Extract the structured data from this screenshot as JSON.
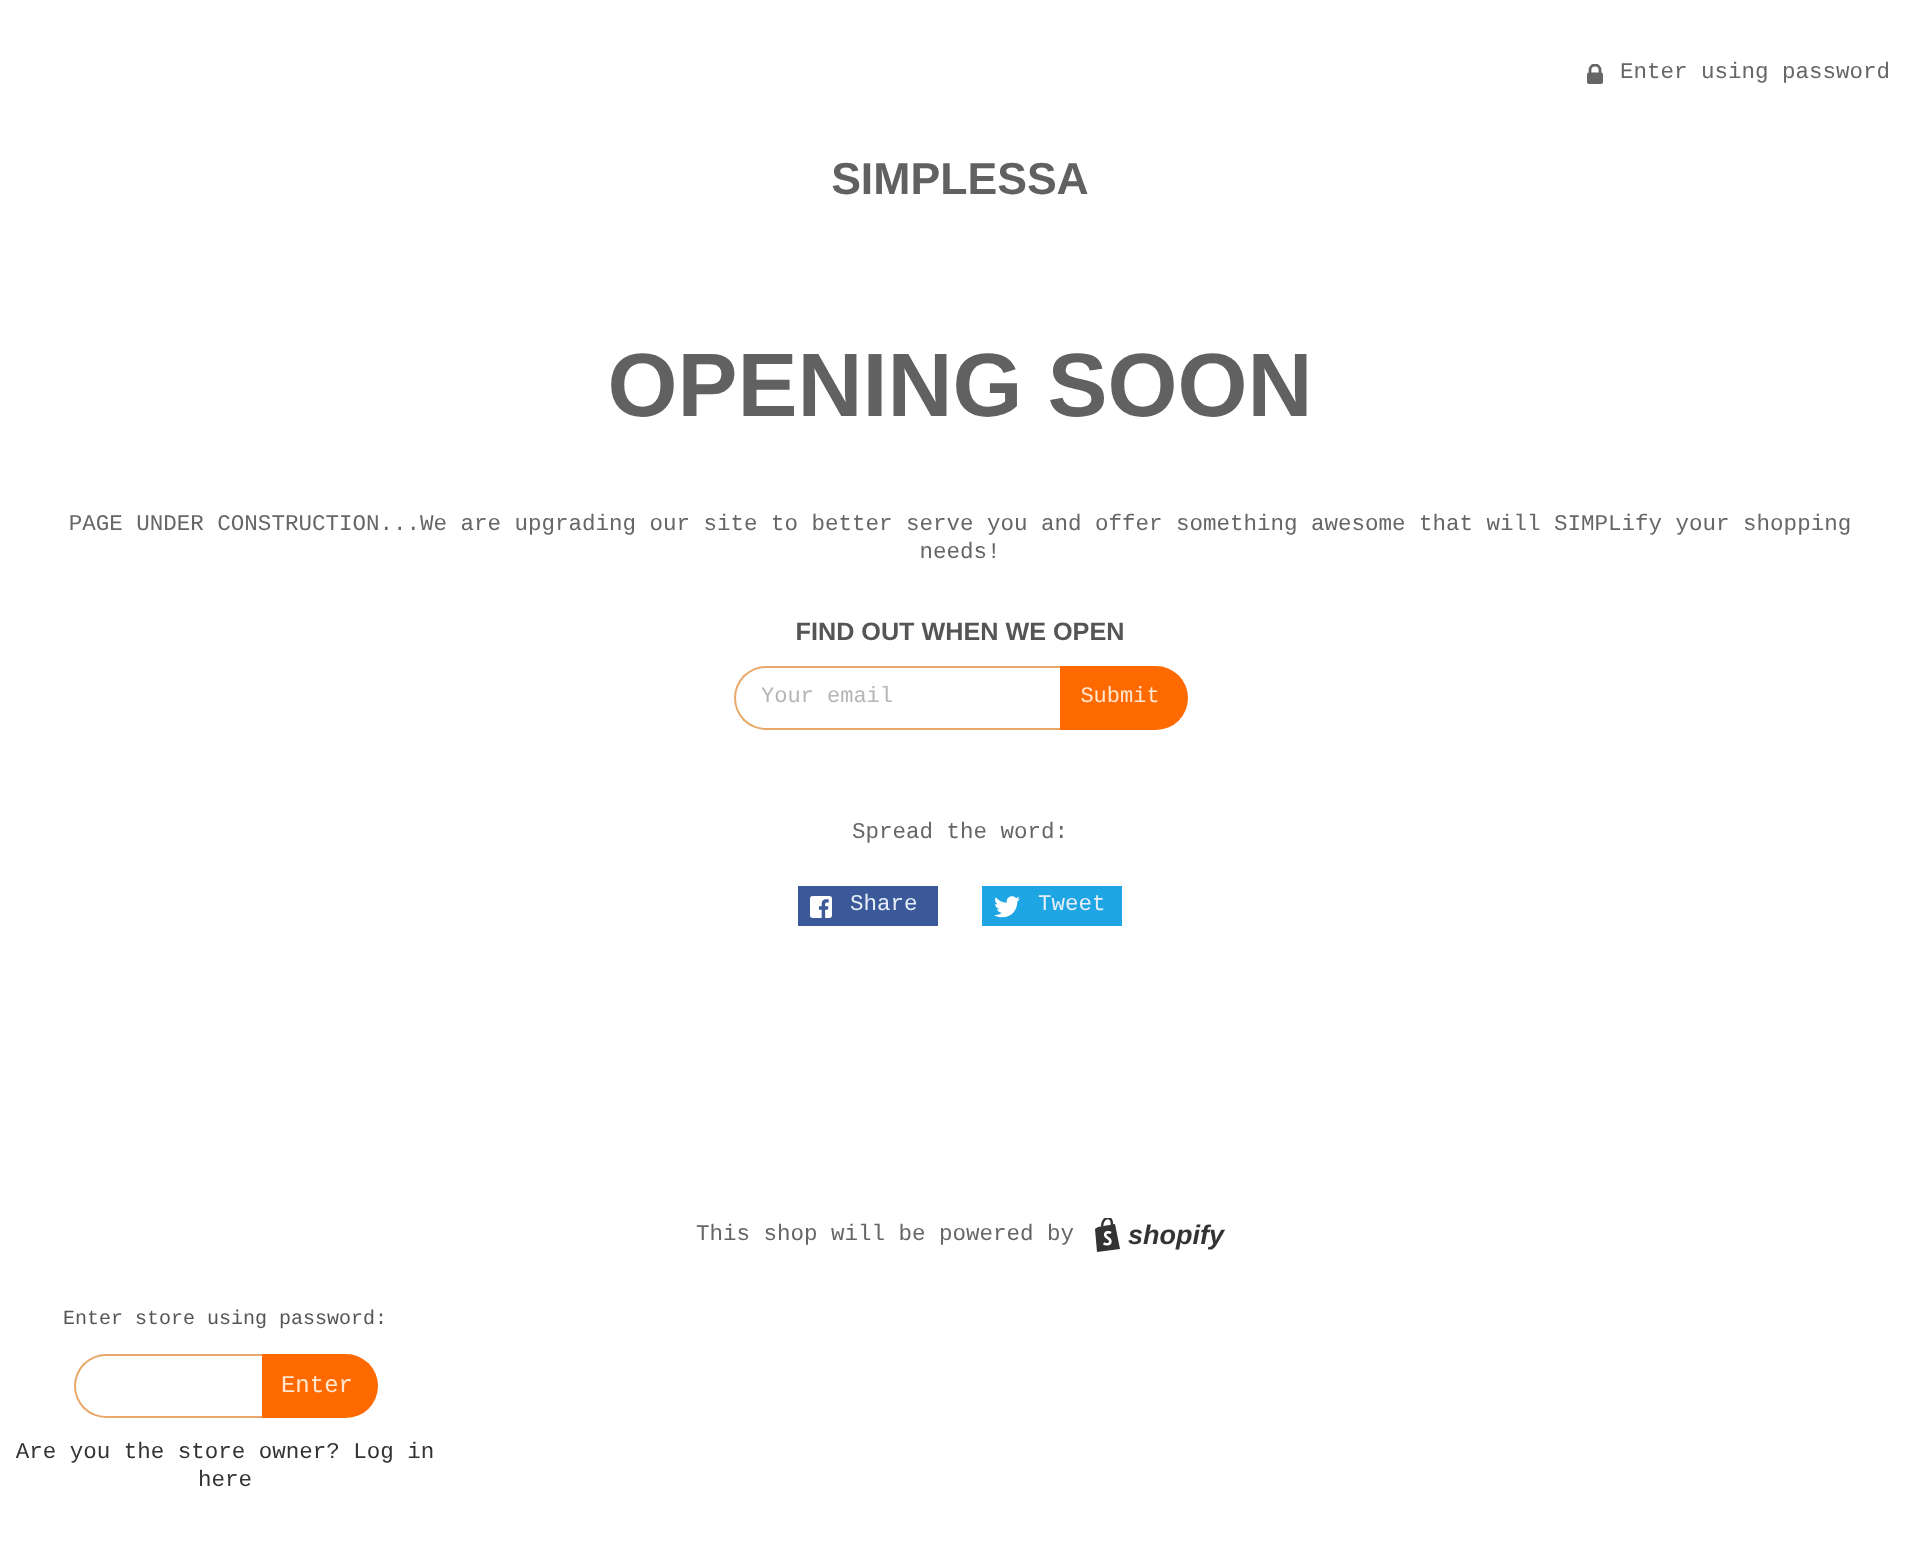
{
  "header": {
    "password_link": "Enter using password"
  },
  "brand": "SIMPLESSA",
  "hero": {
    "title": "OPENING SOON",
    "message": "PAGE UNDER CONSTRUCTION...We are upgrading our site to better serve you and offer something awesome that will SIMPLify your shopping needs!"
  },
  "signup": {
    "heading": "FIND OUT WHEN WE OPEN",
    "email": {
      "placeholder": "Your email"
    },
    "button": "Submit"
  },
  "share": {
    "label": "Spread the word:",
    "buttons": [
      {
        "kind": "facebook",
        "label": "Share"
      },
      {
        "kind": "twitter",
        "label": "Tweet"
      }
    ]
  },
  "footer": {
    "powered_by": "This shop will be powered by",
    "logo": "shopify"
  },
  "password_login": {
    "label": "Enter store using password:",
    "button": "Enter",
    "owner_note": "Are you the store owner? Log in here"
  }
}
